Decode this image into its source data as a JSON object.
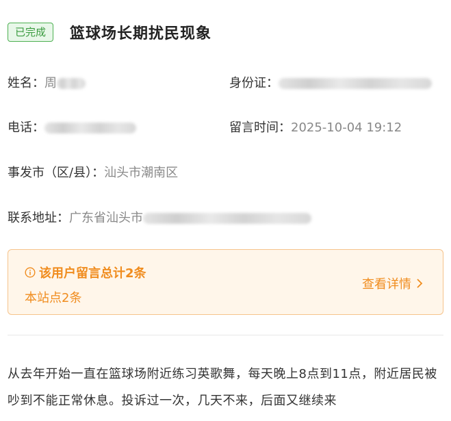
{
  "header": {
    "status": "已完成",
    "title": "篮球场长期扰民现象"
  },
  "fields": {
    "name_label": "姓名：",
    "name_value": "周",
    "id_label": "身份证：",
    "phone_label": "电话：",
    "time_label": "留言时间：",
    "time_value": "2025-10-04 19:12",
    "city_label": "事发市（区/县）：",
    "city_value": "汕头市潮南区",
    "address_label": "联系地址：",
    "address_value": "广东省汕头市"
  },
  "notice": {
    "title": "该用户留言总计2条",
    "sub": "本站点2条",
    "link": "查看详情"
  },
  "content": {
    "text": "从去年开始一直在篮球场附近练习英歌舞，每天晚上8点到11点，附近居民被吵到不能正常休息。投诉过一次，几天不来，后面又继续来"
  },
  "colors": {
    "status_green": "#3a9b3f",
    "accent_orange": "#f08c1e"
  },
  "icons": {
    "notice": "info-circle-icon",
    "link": "chevron-right-icon"
  }
}
